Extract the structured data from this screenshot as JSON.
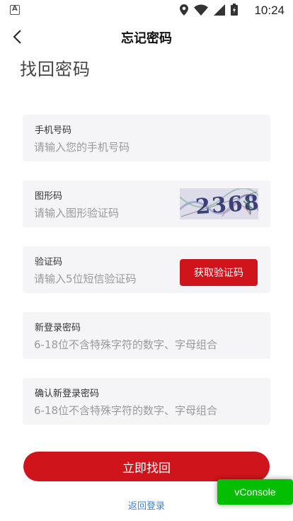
{
  "status_bar": {
    "time": "10:24"
  },
  "header": {
    "title": "忘记密码"
  },
  "heading": "找回密码",
  "fields": {
    "phone": {
      "label": "手机号码",
      "placeholder": "请输入您的手机号码"
    },
    "captcha": {
      "label": "图形码",
      "placeholder": "请输入图形验证码",
      "image_text": "2368"
    },
    "sms": {
      "label": "验证码",
      "placeholder": "请输入5位短信验证码",
      "button_label": "获取验证码"
    },
    "new_password": {
      "label": "新登录密码",
      "placeholder": "6-18位不含特殊字符的数字、字母组合"
    },
    "confirm_password": {
      "label": "确认新登录密码",
      "placeholder": "6-18位不含特殊字符的数字、字母组合"
    }
  },
  "submit_label": "立即找回",
  "back_to_login": "返回登录",
  "vconsole_label": "vConsole",
  "colors": {
    "primary_red": "#d0141b",
    "link_blue": "#3b84d8",
    "vconsole_green": "#04be02",
    "field_bg": "#f5f5f7"
  }
}
